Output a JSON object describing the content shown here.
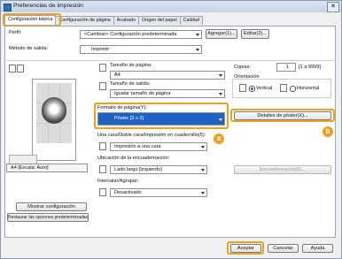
{
  "window": {
    "title": "Preferencias de impresión",
    "close_glyph": "✕"
  },
  "tabs": [
    {
      "label": "Configuración básica"
    },
    {
      "label": "Configuración de página"
    },
    {
      "label": "Acabado"
    },
    {
      "label": "Origen del papel"
    },
    {
      "label": "Calidad"
    }
  ],
  "profile": {
    "label": "Perfil:",
    "value": "<Cambiar> Configuración predeterminada",
    "add_button": "Agregar(1)...",
    "edit_button": "Editar(2)..."
  },
  "output_method": {
    "label": "Método de salida:",
    "value": "Imprimir"
  },
  "preview": {
    "caption": "A4 [Escala: Auto]"
  },
  "page_size": {
    "label": "Tamaño de página:",
    "value": "A4"
  },
  "output_size": {
    "label": "Tamaño de salida:",
    "value": "Igualar tamaño de página"
  },
  "copies": {
    "label": "Copias:",
    "value": "1",
    "range": "[1 a 9999]"
  },
  "orientation": {
    "label": "Orientación",
    "vertical": "Vertical",
    "horizontal": "Horizontal"
  },
  "page_layout": {
    "label": "Formato de página(Y):",
    "value": "Póster [3 x 3]",
    "details_button": "Detalles de póster(X)..."
  },
  "duplex": {
    "label": "Una cara/Doble cara/Impresión en cuadernillo(5):",
    "value": "Impresión a una cara"
  },
  "binding": {
    "label": "Ubicación de la encuadernación:",
    "value": "Lado largo [izquierdo]",
    "button": "Encuadernación(6)..."
  },
  "collate": {
    "label": "Intercalar/Agrupar:",
    "value": "Desactivado"
  },
  "left_buttons": {
    "show_settings": "Mostrar configuración",
    "restore_defaults": "Restaurar las opciones predeterminadas"
  },
  "footer": {
    "ok": "Aceptar",
    "cancel": "Cancelar",
    "help": "Ayuda"
  },
  "callouts": {
    "a": "a",
    "b": "b"
  },
  "colors": {
    "highlight": "#f0a020",
    "selection": "#1e63c4"
  }
}
